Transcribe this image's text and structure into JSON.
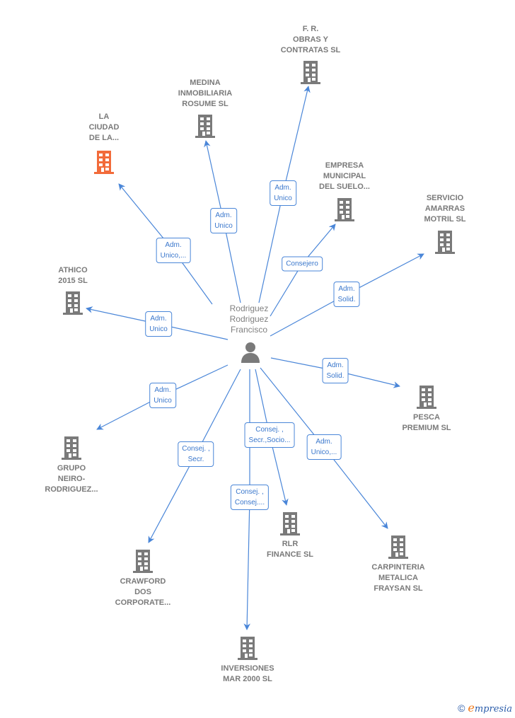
{
  "colors": {
    "edge": "#4a86d8",
    "node": "#7a7a7a",
    "highlight": "#f26b3a"
  },
  "center": {
    "name": "Rodriguez\nRodriguez\nFrancisco",
    "icon": "person-icon"
  },
  "companies": [
    {
      "id": "la-ciudad",
      "name": "LA\nCIUDAD\nDE LA...",
      "highlight": true
    },
    {
      "id": "medina",
      "name": "MEDINA\nINMOBILIARIA\nROSUME  SL",
      "highlight": false
    },
    {
      "id": "fr-obras",
      "name": "F.  R.\nOBRAS Y\nCONTRATAS SL",
      "highlight": false
    },
    {
      "id": "empresa-municipal",
      "name": "EMPRESA\nMUNICIPAL\nDEL SUELO...",
      "highlight": false
    },
    {
      "id": "servicio-amarras",
      "name": "SERVICIO\nAMARRAS\nMOTRIL SL",
      "highlight": false
    },
    {
      "id": "athico",
      "name": "ATHICO\n2015  SL",
      "highlight": false
    },
    {
      "id": "pesca-premium",
      "name": "PESCA\nPREMIUM  SL",
      "highlight": false
    },
    {
      "id": "grupo-neiro",
      "name": "GRUPO\nNEIRO-\nRODRIGUEZ...",
      "highlight": false
    },
    {
      "id": "carpinteria",
      "name": "CARPINTERIA\nMETALICA\nFRAYSAN  SL",
      "highlight": false
    },
    {
      "id": "rlr-finance",
      "name": "RLR\nFINANCE  SL",
      "highlight": false
    },
    {
      "id": "crawford",
      "name": "CRAWFORD\nDOS\nCORPORATE...",
      "highlight": false
    },
    {
      "id": "inversiones",
      "name": "INVERSIONES\nMAR 2000 SL",
      "highlight": false
    }
  ],
  "edges": [
    {
      "to": "la-ciudad",
      "label": "Adm.\nUnico,..."
    },
    {
      "to": "medina",
      "label": "Adm.\nUnico"
    },
    {
      "to": "fr-obras",
      "label": "Adm.\nUnico"
    },
    {
      "to": "empresa-municipal",
      "label": "Consejero"
    },
    {
      "to": "servicio-amarras",
      "label": "Adm.\nSolid."
    },
    {
      "to": "athico",
      "label": "Adm.\nUnico"
    },
    {
      "to": "pesca-premium",
      "label": "Adm.\nSolid."
    },
    {
      "to": "grupo-neiro",
      "label": "Adm.\nUnico"
    },
    {
      "to": "carpinteria",
      "label": "Adm.\nUnico,..."
    },
    {
      "to": "rlr-finance",
      "label": "Consej. ,\nSecr.,Socio..."
    },
    {
      "to": "crawford",
      "label": "Consej. ,\nSecr."
    },
    {
      "to": "inversiones",
      "label": "Consej. ,\nConsej...."
    }
  ],
  "footer": {
    "copyright": "©",
    "brand_initial": "e",
    "brand_rest": "mpresia"
  }
}
